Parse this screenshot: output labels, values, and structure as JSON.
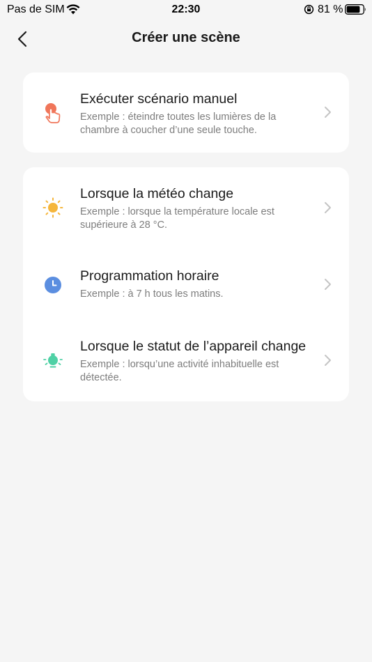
{
  "status_bar": {
    "carrier": "Pas de SIM",
    "time": "22:30",
    "battery_percent": "81 %",
    "battery_level": 0.81
  },
  "nav": {
    "title": "Créer une scène"
  },
  "manual": {
    "title": "Exécuter scénario manuel",
    "description": "Exemple : éteindre toutes les lumières de la chambre à coucher d’une seule touche.",
    "icon": "tap-icon",
    "icon_color": "#f0765a"
  },
  "automations": [
    {
      "title": "Lorsque la météo change",
      "description": "Exemple : lorsque la température locale est supérieure à 28 °C.",
      "icon": "sun-icon",
      "icon_color": "#f5b63c"
    },
    {
      "title": "Programmation horaire",
      "description": "Exemple : à 7 h tous les matins.",
      "icon": "clock-icon",
      "icon_color": "#5b8ee0"
    },
    {
      "title": "Lorsque le statut de l’appareil change",
      "description": "Exemple : lorsqu’une activité inhabituelle est détectée.",
      "icon": "device-icon",
      "icon_color": "#4fd1a5"
    }
  ]
}
